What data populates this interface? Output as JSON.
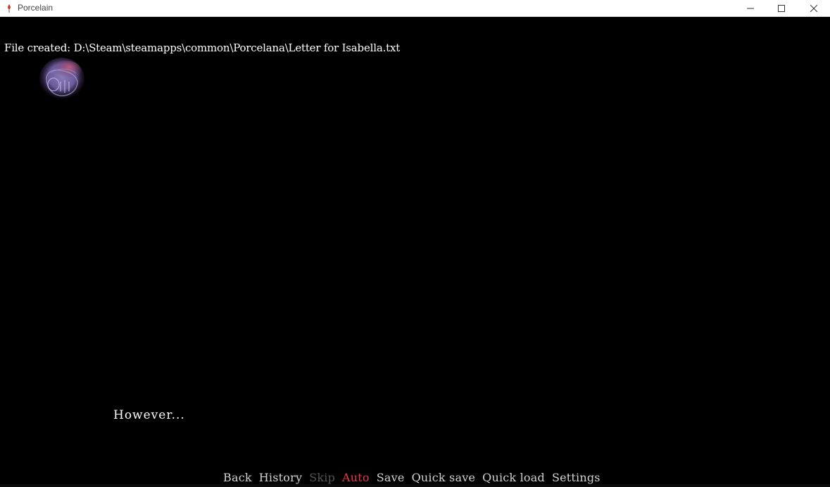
{
  "window": {
    "title": "Porcelain",
    "accent_icon_color": "#c0392b",
    "controls": [
      "minimize-icon",
      "maximize-icon",
      "close-icon"
    ]
  },
  "game": {
    "notification": "File created: D:\\Steam\\steamapps\\common\\Porcelana\\Letter for Isabella.txt",
    "dialogue": "However...",
    "quick_menu": [
      {
        "label": "Back",
        "state": "normal"
      },
      {
        "label": "History",
        "state": "normal"
      },
      {
        "label": "Skip",
        "state": "disabled"
      },
      {
        "label": "Auto",
        "state": "active"
      },
      {
        "label": "Save",
        "state": "normal"
      },
      {
        "label": "Quick save",
        "state": "normal"
      },
      {
        "label": "Quick load",
        "state": "normal"
      },
      {
        "label": "Settings",
        "state": "normal"
      }
    ],
    "colors": {
      "background": "#000000",
      "text": "#ffffff",
      "menu_text": "#d2d2d2",
      "menu_disabled": "#555555",
      "menu_active": "#e8394c"
    }
  }
}
